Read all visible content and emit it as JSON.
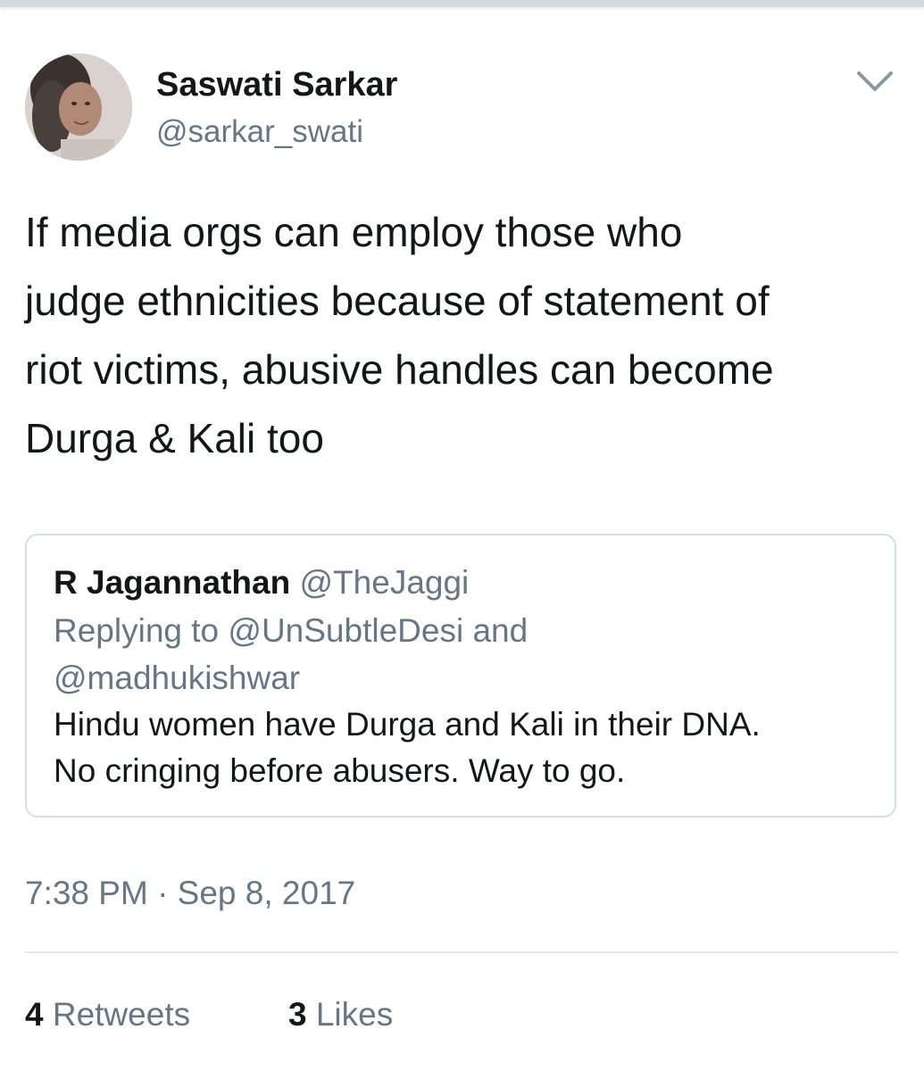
{
  "tweet": {
    "author": {
      "display_name": "Saswati Sarkar",
      "handle": "@sarkar_swati"
    },
    "text_lines": [
      "If media orgs can employ those who",
      "judge ethnicities because of statement of",
      "riot victims, abusive handles can become",
      "Durga & Kali too"
    ],
    "timestamp": "7:38 PM · Sep 8, 2017",
    "stats": {
      "retweets_count": "4",
      "retweets_label": "Retweets",
      "likes_count": "3",
      "likes_label": "Likes"
    }
  },
  "quoted": {
    "display_name": "R Jagannathan",
    "handle": "@TheJaggi",
    "reply_line_1": "Replying to @UnSubtleDesi and",
    "reply_line_2": "@madhukishwar",
    "body_line_1": "Hindu women have Durga and Kali in their DNA.",
    "body_line_2": "No cringing before abusers. Way to go."
  },
  "icons": {
    "menu": "chevron-down-icon",
    "avatar": "profile-photo"
  },
  "colors": {
    "text_primary": "#14171a",
    "text_secondary": "#657786",
    "border": "#d7dde3"
  }
}
